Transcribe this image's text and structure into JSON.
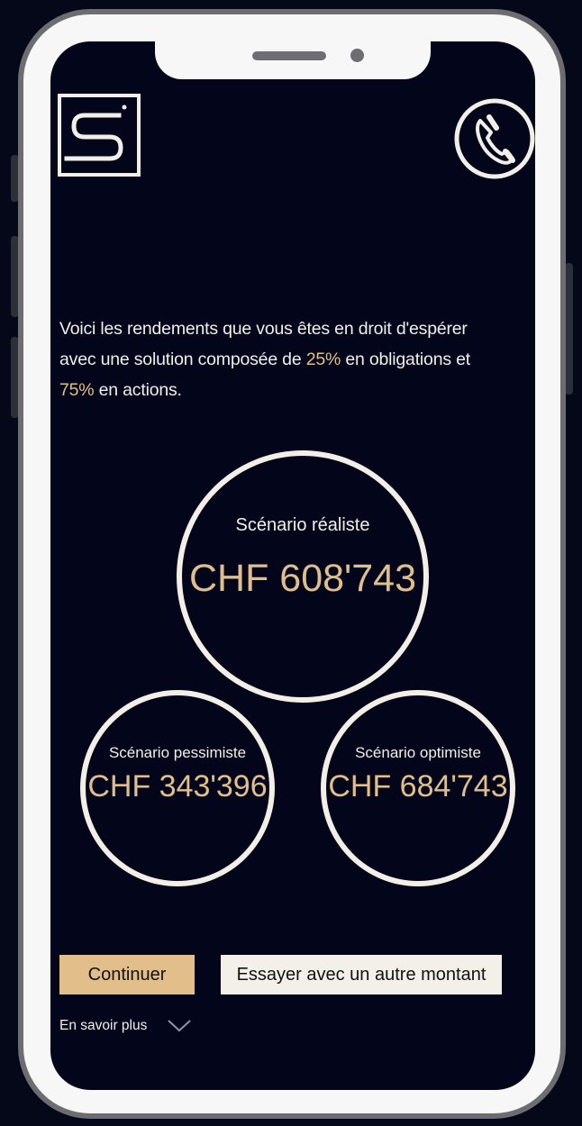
{
  "intro": {
    "line1": "Voici les rendements que vous êtes en droit d'espérer",
    "line2_prefix": "avec une solution composée de ",
    "bond_pct": "25%",
    "line2_suffix": " en obligations et",
    "equity_pct": "75%",
    "line3_suffix": " en actions."
  },
  "scenarios": {
    "realistic": {
      "label": "Scénario réaliste",
      "value": "CHF 608'743"
    },
    "pessimistic": {
      "label": "Scénario pessimiste",
      "value": "CHF 343'396"
    },
    "optimistic": {
      "label": "Scénario optimiste",
      "value": "CHF 684'743"
    }
  },
  "actions": {
    "continue_label": "Continuer",
    "other_amount_label": "Essayer avec un autre montant",
    "learn_more_label": "En savoir plus"
  },
  "icons": {
    "logo": "s-logo-icon",
    "phone": "phone-icon",
    "chevron": "chevron-down-icon"
  },
  "colors": {
    "background": "#03051a",
    "accent_gold": "#e2bf8a",
    "text_light": "#f2efe9"
  }
}
